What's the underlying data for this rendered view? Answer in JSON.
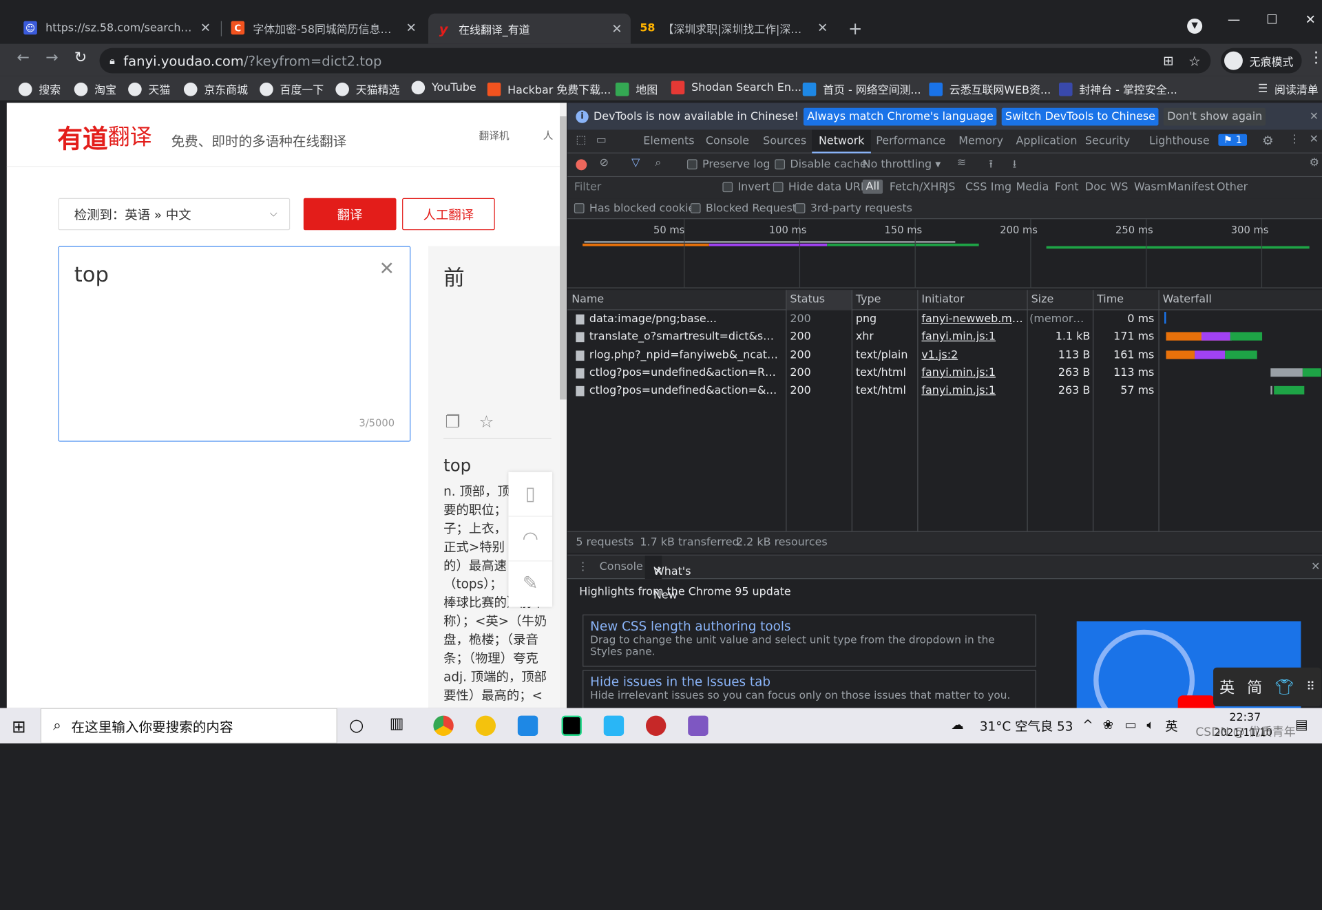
{
  "tabs": [
    {
      "title": "https://sz.58.com/searchjob_",
      "favicon_color": "#3b5bdb",
      "favicon_text": "☺"
    },
    {
      "title": "字体加密-58同城简历信息爬取_",
      "favicon_color": "#f2531f",
      "favicon_text": "C"
    },
    {
      "title": "在线翻译_有道",
      "favicon_color": "#e31d1a",
      "favicon_text": "y",
      "active": true
    },
    {
      "title": "【深圳求职|深圳找工作|深圳求职",
      "favicon_color": "#ffb300",
      "favicon_text": "58"
    }
  ],
  "address": {
    "host": "fanyi.youdao.com",
    "path": "/?keyfrom=dict2.top"
  },
  "incognito_label": "无痕模式",
  "bookmarks": [
    {
      "label": "搜索",
      "kind": "globe"
    },
    {
      "label": "淘宝",
      "kind": "globe"
    },
    {
      "label": "天猫",
      "kind": "globe"
    },
    {
      "label": "京东商城",
      "kind": "globe"
    },
    {
      "label": "百度一下",
      "kind": "globe"
    },
    {
      "label": "天猫精选",
      "kind": "globe"
    },
    {
      "label": "YouTube",
      "kind": "globe"
    },
    {
      "label": "Hackbar 免费下载...",
      "kind": "csdn"
    },
    {
      "label": "地图",
      "kind": "map"
    },
    {
      "label": "Shodan Search En...",
      "kind": "shodan"
    },
    {
      "label": "首页 - 网络空间测...",
      "kind": "zoomeye"
    },
    {
      "label": "云悉互联网WEB资...",
      "kind": "yunxi"
    },
    {
      "label": "封神台 - 掌控安全...",
      "kind": "fst"
    }
  ],
  "reading_list": "阅读清单",
  "youdao": {
    "logo_brand": "有道",
    "logo_product": "翻译",
    "slogan": "免费、即时的多语种在线翻译",
    "nav": [
      "翻译机",
      "人"
    ],
    "lang_select": "检测到：英语 » 中文",
    "translate_btn": "翻译",
    "human_btn": "人工翻译",
    "input_text": "top",
    "char_count": "3/5000",
    "result": "前",
    "dict_word": "top",
    "dict_def": "n. 顶部，顶\n要的职位；\n子；上衣，\n正式>特别\n的）最高速\n（tops）；\n棒球比赛的）前半\n称）；<英>（牛奶\n盘，桅楼；（录音\n条；（物理）夸克\nadj. 顶端的，顶部\n要性）最高的；<"
  },
  "devtools": {
    "infobar": {
      "text": "DevTools is now available in Chinese!",
      "btn1": "Always match Chrome's language",
      "btn2": "Switch DevTools to Chinese",
      "btn3": "Don't show again"
    },
    "tabs": [
      "Elements",
      "Console",
      "Sources",
      "Network",
      "Performance",
      "Memory",
      "Application",
      "Security",
      "Lighthouse"
    ],
    "active_tab": "Network",
    "issues_count": "1",
    "toolbar": {
      "preserve_log": "Preserve log",
      "disable_cache": "Disable cache",
      "throttling": "No throttling"
    },
    "filter": {
      "placeholder": "Filter",
      "invert": "Invert",
      "hide_data_urls": "Hide data URLs",
      "types": [
        "All",
        "Fetch/XHR",
        "JS",
        "CSS",
        "Img",
        "Media",
        "Font",
        "Doc",
        "WS",
        "Wasm",
        "Manifest",
        "Other"
      ]
    },
    "filter2": {
      "blocked_cookies": "Has blocked cookies",
      "blocked_requests": "Blocked Requests",
      "third_party": "3rd-party requests"
    },
    "timeline_labels": [
      "50 ms",
      "100 ms",
      "150 ms",
      "200 ms",
      "250 ms",
      "300 ms"
    ],
    "columns": [
      "Name",
      "Status",
      "Type",
      "Initiator",
      "Size",
      "Time",
      "Waterfall"
    ],
    "requests": [
      {
        "name": "data:image/png;base...",
        "status": "200",
        "type": "png",
        "initiator": "fanyi-newweb.min.css",
        "size": "(memory c...",
        "time": "0 ms",
        "dim": true
      },
      {
        "name": "translate_o?smartresult=dict&smartresul...",
        "status": "200",
        "type": "xhr",
        "initiator": "fanyi.min.js:1",
        "size": "1.1 kB",
        "time": "171 ms"
      },
      {
        "name": "rlog.php?_npid=fanyiweb&_ncat=event...",
        "status": "200",
        "type": "text/plain",
        "initiator": "v1.js:2",
        "size": "113 B",
        "time": "161 ms"
      },
      {
        "name": "ctlog?pos=undefined&action=RESULT_...",
        "status": "200",
        "type": "text/html",
        "initiator": "fanyi.min.js:1",
        "size": "263 B",
        "time": "113 ms"
      },
      {
        "name": "ctlog?pos=undefined&action=&sentenc...",
        "status": "200",
        "type": "text/html",
        "initiator": "fanyi.min.js:1",
        "size": "263 B",
        "time": "57 ms"
      }
    ],
    "status": {
      "requests": "5 requests",
      "transferred": "1.7 kB transferred",
      "resources": "2.2 kB resources"
    },
    "drawer": {
      "tabs": [
        "Console",
        "What's New"
      ],
      "headline": "Highlights from the Chrome 95 update",
      "cards": [
        {
          "title": "New CSS length authoring tools",
          "desc": "Drag to change the unit value and select unit type from the dropdown in the Styles pane."
        },
        {
          "title": "Hide issues in the Issues tab",
          "desc": "Hide irrelevant issues so you can focus only on those issues that matter to you."
        }
      ]
    },
    "ime": [
      "英",
      "简"
    ]
  },
  "taskbar": {
    "search_placeholder": "在这里输入你要搜索的内容",
    "weather": "31°C 空气良 53",
    "ime": "英",
    "time": "22:37",
    "date": "2021/11/10",
    "watermark": "CSDN @ 优质青年"
  },
  "colors": {
    "accent": "#1a73e8",
    "youdao_red": "#e31d1a",
    "wf_orange": "#e8710a",
    "wf_purple": "#a142f4",
    "wf_green": "#1ea446",
    "wf_gray": "#9aa0a6"
  }
}
